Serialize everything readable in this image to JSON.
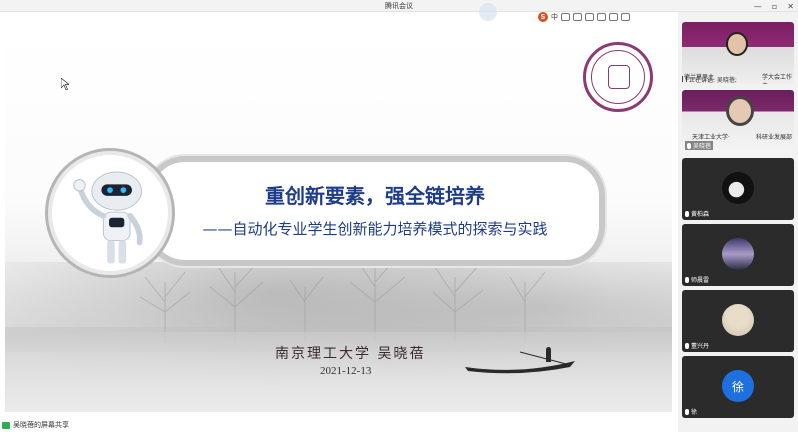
{
  "window": {
    "title": "腾讯会议",
    "min_glyph": "—",
    "max_glyph": "▫",
    "close_glyph": "✕"
  },
  "ime": {
    "logo": "S",
    "mode": "中"
  },
  "slide": {
    "main_title": "重创新要素，强全链培养",
    "sub_title": "——自动化专业学生创新能力培养模式的探索与实践",
    "author": "南京理工大学  吴晓蓓",
    "date": "2021-12-13"
  },
  "share_status": {
    "label": "吴晓蓓的屏幕共享"
  },
  "participants": [
    {
      "name": "",
      "speaking_label": "正在讲话: 吴晓蓓;",
      "banner_left": "德兰莫思主",
      "banner_right": "学大会工作夫"
    },
    {
      "name": "吴晓蓓",
      "banner_left": "天津工业大学·",
      "banner_right": "科研业发展部"
    },
    {
      "name": "黄柏森"
    },
    {
      "name": "师晨雷"
    },
    {
      "name": "董兴丹"
    },
    {
      "name": "徐",
      "avatar_letter": "徐"
    }
  ],
  "colors": {
    "title_blue": "#1f3c88",
    "logo_purple": "#8a3a74",
    "share_green": "#2fae53",
    "avatar_blue": "#1e6fe0"
  }
}
